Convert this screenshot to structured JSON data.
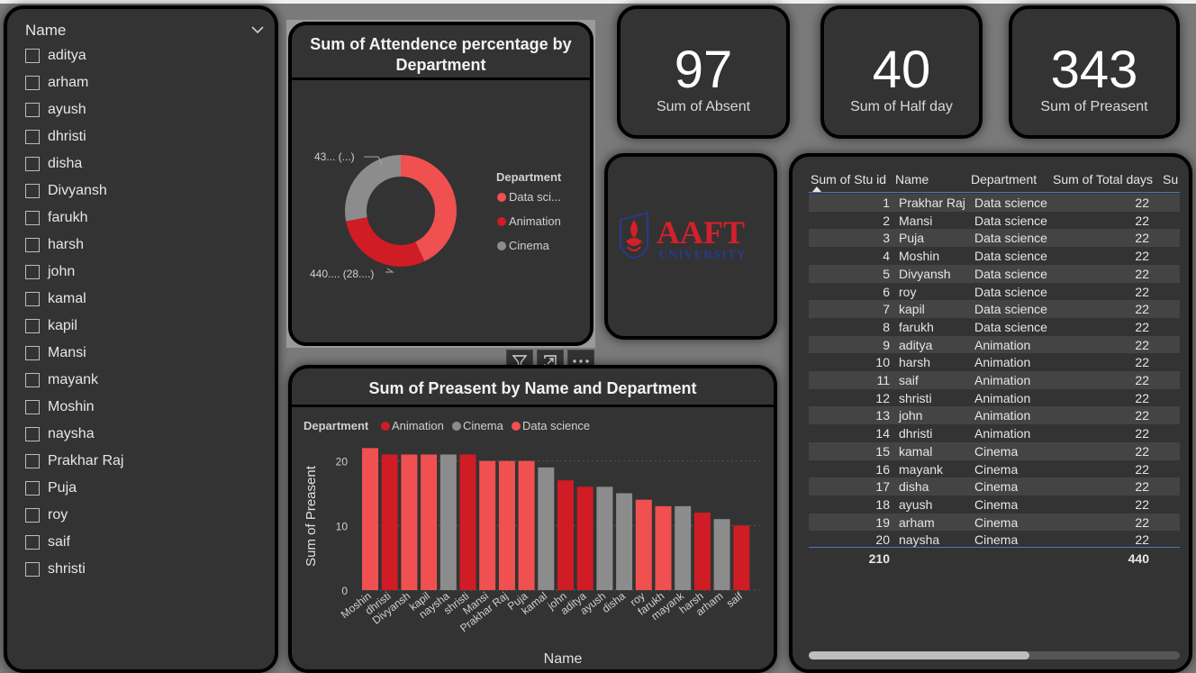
{
  "slicer": {
    "title": "Name",
    "items": [
      "aditya",
      "arham",
      "ayush",
      "dhristi",
      "disha",
      "Divyansh",
      "farukh",
      "harsh",
      "john",
      "kamal",
      "kapil",
      "Mansi",
      "mayank",
      "Moshin",
      "naysha",
      "Prakhar Raj",
      "Puja",
      "roy",
      "saif",
      "shristi"
    ]
  },
  "donut": {
    "title_line1": "Sum of Attendence percentage by",
    "title_line2": "Department",
    "label_top": "43... (...)",
    "label_bottom": "440.... (28....)",
    "legend_title": "Department",
    "legend": [
      {
        "name": "Data sci...",
        "color": "#f05050"
      },
      {
        "name": "Animation",
        "color": "#d01c24"
      },
      {
        "name": "Cinema",
        "color": "#8c8c8c"
      }
    ],
    "slices": [
      {
        "name": "Data science",
        "share": 0.43,
        "color": "#f05050"
      },
      {
        "name": "Animation",
        "share": 0.29,
        "color": "#d01c24"
      },
      {
        "name": "Cinema",
        "share": 0.28,
        "color": "#8c8c8c"
      }
    ]
  },
  "kpis": [
    {
      "value": "97",
      "label": "Sum of Absent"
    },
    {
      "value": "40",
      "label": "Sum of Half day"
    },
    {
      "value": "343",
      "label": "Sum of Preasent"
    }
  ],
  "logo": {
    "top": "AAFT",
    "bottom": "UNIVERSITY"
  },
  "bar_chart": {
    "title": "Sum of Preasent by Name and Department",
    "legend_title": "Department",
    "legend": [
      {
        "name": "Animation",
        "color": "#d01c24"
      },
      {
        "name": "Cinema",
        "color": "#8c8c8c"
      },
      {
        "name": "Data science",
        "color": "#f05050"
      }
    ],
    "ylabel": "Sum of Preasent",
    "xlabel": "Name",
    "yticks": [
      "0",
      "10",
      "20"
    ]
  },
  "chart_data": {
    "type": "bar",
    "title": "Sum of Preasent by Name and Department",
    "xlabel": "Name",
    "ylabel": "Sum of Preasent",
    "ylim": [
      0,
      22
    ],
    "grid": true,
    "legend_position": "top-left",
    "categories": [
      "Moshin",
      "dhristi",
      "Divyansh",
      "kapil",
      "naysha",
      "shristi",
      "Mansi",
      "Prakhar Raj",
      "Puja",
      "kamal",
      "john",
      "aditya",
      "ayush",
      "disha",
      "roy",
      "farukh",
      "mayank",
      "harsh",
      "arham",
      "saif"
    ],
    "values": [
      22,
      21,
      21,
      21,
      21,
      21,
      20,
      20,
      20,
      19,
      17,
      16,
      16,
      15,
      14,
      13,
      13,
      12,
      11,
      10
    ],
    "departments": [
      "Data science",
      "Animation",
      "Data science",
      "Data science",
      "Cinema",
      "Animation",
      "Data science",
      "Data science",
      "Data science",
      "Cinema",
      "Animation",
      "Animation",
      "Cinema",
      "Cinema",
      "Data science",
      "Data science",
      "Cinema",
      "Animation",
      "Cinema",
      "Animation"
    ],
    "colors": {
      "Animation": "#d01c24",
      "Cinema": "#8c8c8c",
      "Data science": "#f05050"
    }
  },
  "table": {
    "headers": [
      "Sum of Stu id",
      "Name",
      "Department",
      "Sum of Total days",
      "Su"
    ],
    "rows": [
      [
        "1",
        "Prakhar Raj",
        "Data science",
        "22"
      ],
      [
        "2",
        "Mansi",
        "Data science",
        "22"
      ],
      [
        "3",
        "Puja",
        "Data science",
        "22"
      ],
      [
        "4",
        "Moshin",
        "Data science",
        "22"
      ],
      [
        "5",
        "Divyansh",
        "Data science",
        "22"
      ],
      [
        "6",
        "roy",
        "Data science",
        "22"
      ],
      [
        "7",
        "kapil",
        "Data science",
        "22"
      ],
      [
        "8",
        "farukh",
        "Data science",
        "22"
      ],
      [
        "9",
        "aditya",
        "Animation",
        "22"
      ],
      [
        "10",
        "harsh",
        "Animation",
        "22"
      ],
      [
        "11",
        "saif",
        "Animation",
        "22"
      ],
      [
        "12",
        "shristi",
        "Animation",
        "22"
      ],
      [
        "13",
        "john",
        "Animation",
        "22"
      ],
      [
        "14",
        "dhristi",
        "Animation",
        "22"
      ],
      [
        "15",
        "kamal",
        "Cinema",
        "22"
      ],
      [
        "16",
        "mayank",
        "Cinema",
        "22"
      ],
      [
        "17",
        "disha",
        "Cinema",
        "22"
      ],
      [
        "18",
        "ayush",
        "Cinema",
        "22"
      ],
      [
        "19",
        "arham",
        "Cinema",
        "22"
      ],
      [
        "20",
        "naysha",
        "Cinema",
        "22"
      ]
    ],
    "total_id": "210",
    "total_days": "440"
  },
  "toolbar": {
    "filter_icon": "filter-icon",
    "focus_icon": "focus-mode-icon",
    "more_icon": "more-options-icon"
  }
}
